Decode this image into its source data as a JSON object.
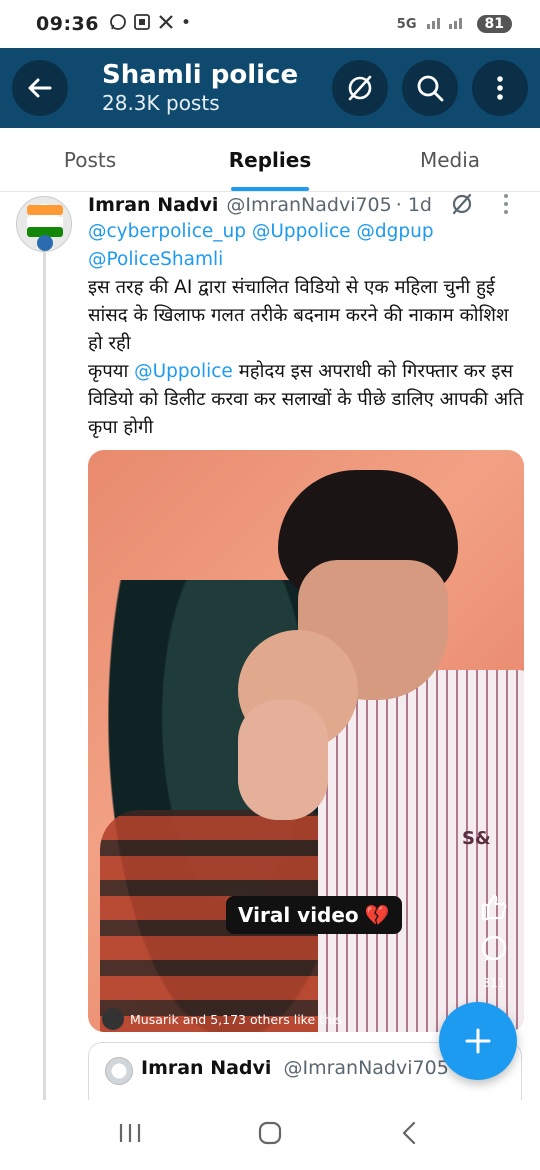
{
  "status_bar": {
    "time": "09:36",
    "notification_icons": [
      "whatsapp-icon",
      "screenshot-icon",
      "x-icon"
    ],
    "dot": "•",
    "network": "5G",
    "battery": "81"
  },
  "header": {
    "profile_name": "Shamli police",
    "post_count": "28.3K posts",
    "icons": [
      "back-arrow-icon",
      "grok-icon",
      "search-icon",
      "more-vertical-icon"
    ]
  },
  "tabs": [
    {
      "label": "Posts",
      "active": false
    },
    {
      "label": "Replies",
      "active": true
    },
    {
      "label": "Media",
      "active": false
    }
  ],
  "tweet": {
    "display_name": "Imran Nadvi",
    "handle": "@ImranNadvi705",
    "time": "· 1d",
    "mentions_line1": "@cyberpolice_up @Uppolice @dgpup",
    "mentions_line2": "@PoliceShamli",
    "body_p1": "इस तरह की AI द्वारा संचालित विडियो से एक महिला चुनी हुई सांसद के खिलाफ गलत तरीके बदनाम करने की नाकाम कोशिश हो रही",
    "body_p2_prefix": "कृपया ",
    "body_p2_mention": "@Uppolice",
    "body_p2_rest": " महोदय इस अपराधी को गिरफ्तार कर इस विडियो को डिलीट करवा कर सलाखों के पीछे डालिए आपकी अति कृपा होगी",
    "media": {
      "overlay_label": "Viral video",
      "overlay_emoji": "💔",
      "shirt_logo": "S&",
      "comment_count": "311",
      "likes_text": "Musarik and 5,173 others like this"
    }
  },
  "quoted_tweet": {
    "display_name": "Imran Nadvi",
    "handle": "@ImranNadvi705"
  },
  "fab": {
    "icon": "plus-icon"
  },
  "nav": {
    "icons": [
      "recents-icon",
      "home-icon",
      "back-icon"
    ]
  },
  "colors": {
    "header_bg": "#0f4a6e",
    "accent": "#1d9bf0",
    "mention": "#1d9bf0"
  }
}
